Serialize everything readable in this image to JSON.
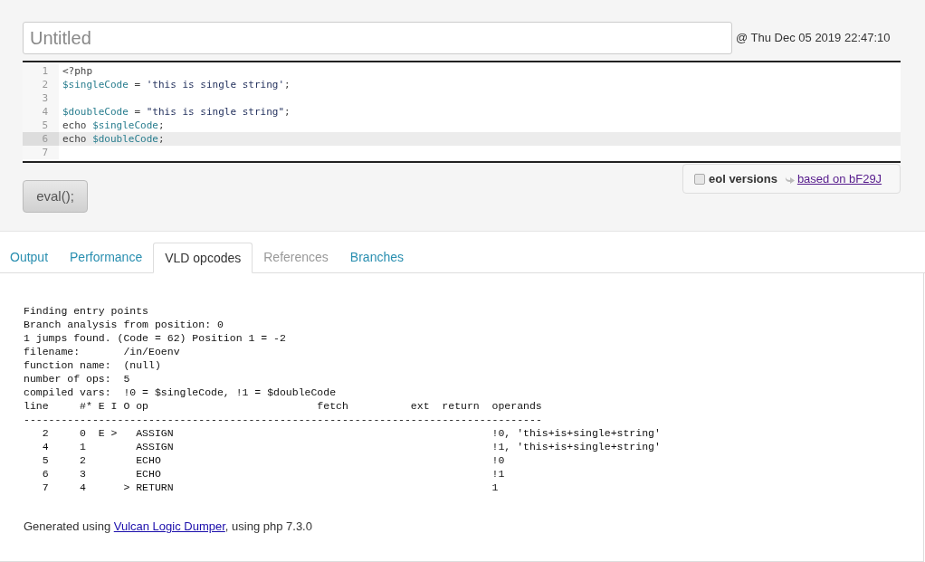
{
  "title_field": {
    "placeholder": "Untitled"
  },
  "timestamp": "@ Thu Dec 05 2019 22:47:10",
  "editor": {
    "lines": [
      {
        "number": "1",
        "active": false,
        "tokens": [
          {
            "kind": "plain",
            "text": "<?php"
          }
        ]
      },
      {
        "number": "2",
        "active": false,
        "tokens": [
          {
            "kind": "var",
            "text": "$singleCode"
          },
          {
            "kind": "plain",
            "text": " = "
          },
          {
            "kind": "str",
            "text": "'this is single string'"
          },
          {
            "kind": "plain",
            "text": ";"
          }
        ]
      },
      {
        "number": "3",
        "active": false
      },
      {
        "number": "4",
        "active": false,
        "tokens": [
          {
            "kind": "var",
            "text": "$doubleCode"
          },
          {
            "kind": "plain",
            "text": " = "
          },
          {
            "kind": "str",
            "text": "\"this is single string\""
          },
          {
            "kind": "plain",
            "text": ";"
          }
        ]
      },
      {
        "number": "5",
        "active": false,
        "tokens": [
          {
            "kind": "plain",
            "text": "echo "
          },
          {
            "kind": "var",
            "text": "$singleCode"
          },
          {
            "kind": "plain",
            "text": ";"
          }
        ]
      },
      {
        "number": "6",
        "active": true,
        "tokens": [
          {
            "kind": "plain",
            "text": "echo "
          },
          {
            "kind": "var",
            "text": "$doubleCode"
          },
          {
            "kind": "plain",
            "text": ";"
          }
        ]
      },
      {
        "number": "7",
        "active": false
      }
    ]
  },
  "eol_versions": {
    "label": "eol versions",
    "checked": false
  },
  "based_on": "based on bF29J",
  "eval_button": "eval();",
  "tabs": [
    {
      "label": "Output",
      "selected": false,
      "disabled": false
    },
    {
      "label": "Performance",
      "selected": false,
      "disabled": false
    },
    {
      "label": "VLD opcodes",
      "selected": true,
      "disabled": false
    },
    {
      "label": "References",
      "selected": false,
      "disabled": true
    },
    {
      "label": "Branches",
      "selected": false,
      "disabled": false
    }
  ],
  "vld": {
    "lines": [
      "Finding entry points",
      "Branch analysis from position: 0",
      "1 jumps found. (Code = 62) Position 1 = -2",
      "filename:       /in/Eoenv",
      "function name:  (null)",
      "number of ops:  5",
      "compiled vars:  !0 = $singleCode, !1 = $doubleCode"
    ],
    "columns": [
      "line",
      "#*",
      "E",
      "I",
      "O",
      "op",
      "fetch",
      "ext",
      "return",
      "operands"
    ],
    "separator": "-----------------------------------------------------------------------------------",
    "rows": [
      {
        "line": "2",
        "num": "0",
        "e": "E",
        "i": ">",
        "o": "",
        "op": "ASSIGN",
        "fetch": "",
        "ext": "",
        "ret": "",
        "operands": "!0, 'this+is+single+string'"
      },
      {
        "line": "4",
        "num": "1",
        "e": "",
        "i": "",
        "o": "",
        "op": "ASSIGN",
        "fetch": "",
        "ext": "",
        "ret": "",
        "operands": "!1, 'this+is+single+string'"
      },
      {
        "line": "5",
        "num": "2",
        "e": "",
        "i": "",
        "o": "",
        "op": "ECHO",
        "fetch": "",
        "ext": "",
        "ret": "",
        "operands": "!0"
      },
      {
        "line": "6",
        "num": "3",
        "e": "",
        "i": "",
        "o": "",
        "op": "ECHO",
        "fetch": "",
        "ext": "",
        "ret": "",
        "operands": "!1"
      },
      {
        "line": "7",
        "num": "4",
        "e": "",
        "i": "",
        "o": ">",
        "op": "RETURN",
        "fetch": "",
        "ext": "",
        "ret": "",
        "operands": "1"
      }
    ]
  },
  "footer": {
    "before": "Generated using ",
    "link": "Vulcan Logic Dumper",
    "after": ", using php 7.3.0"
  }
}
